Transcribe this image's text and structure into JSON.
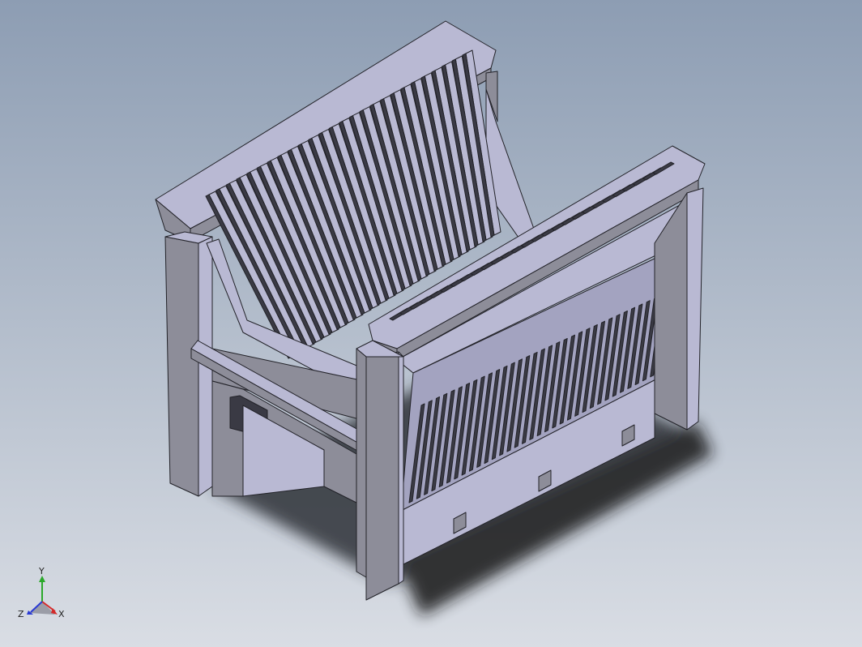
{
  "viewport": {
    "background_top": "#8d9db3",
    "background_bottom": "#d9dde4"
  },
  "model": {
    "name": "wafer-cassette",
    "face_color": "#b9b9d3",
    "side_color": "#8d8d99",
    "dark_color": "#3a3a44",
    "edge_color": "#222228"
  },
  "triad": {
    "x_label": "X",
    "y_label": "Y",
    "z_label": "Z",
    "x_color": "#d42a2a",
    "y_color": "#2aa82a",
    "z_color": "#2a3ad4"
  }
}
